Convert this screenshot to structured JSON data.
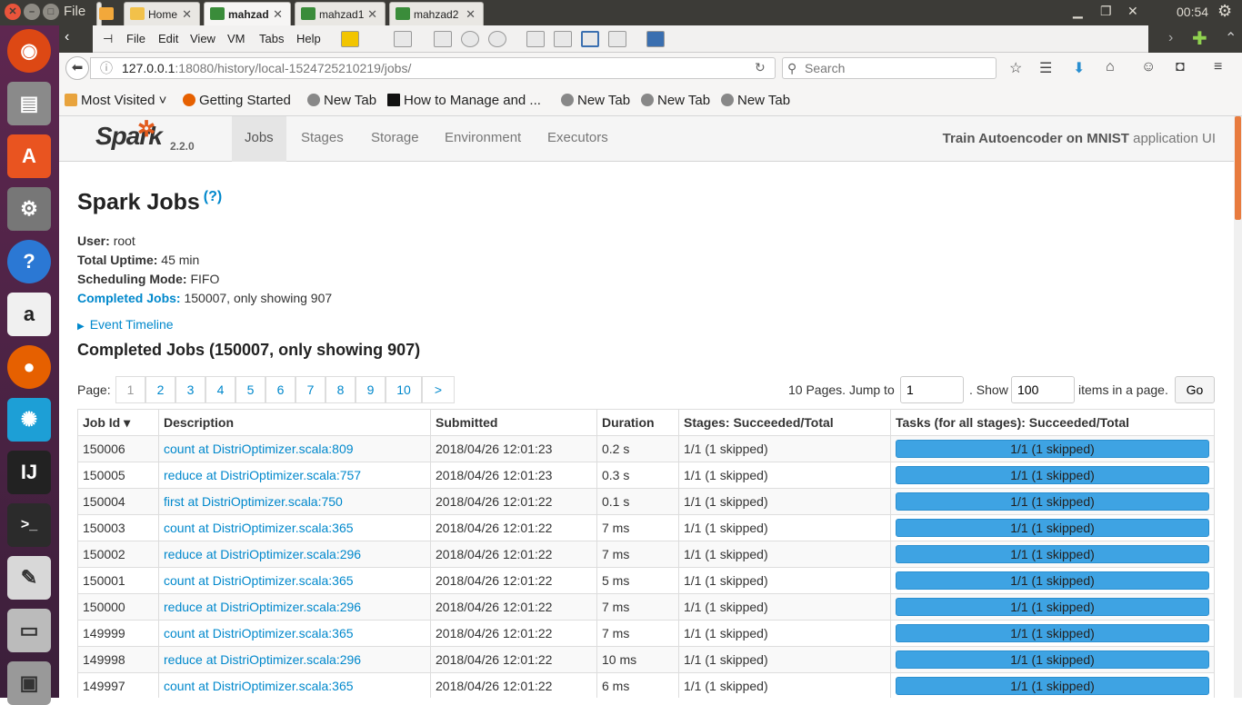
{
  "os": {
    "menu_file": "File",
    "clock": "00:54"
  },
  "browser_tabs": [
    {
      "label": "Home"
    },
    {
      "label": "mahzad"
    },
    {
      "label": "mahzad1"
    },
    {
      "label": "mahzad2"
    }
  ],
  "vm_menu": [
    "File",
    "Edit",
    "View",
    "VM",
    "Tabs",
    "Help"
  ],
  "nav": {
    "url_host": "127.0.0.1",
    "url_path": ":18080/history/local-1524725210219/jobs/",
    "search_placeholder": "Search"
  },
  "bookmarks": [
    {
      "label": "Most Visited ˅"
    },
    {
      "label": "Getting Started"
    },
    {
      "label": "New Tab"
    },
    {
      "label": "How to Manage and ..."
    },
    {
      "label": "New Tab"
    },
    {
      "label": "New Tab"
    },
    {
      "label": "New Tab"
    }
  ],
  "spark": {
    "version": "2.2.0",
    "tabs": [
      "Jobs",
      "Stages",
      "Storage",
      "Environment",
      "Executors"
    ],
    "app_name": "Train Autoencoder on MNIST",
    "app_suffix": " application UI",
    "title": "Spark Jobs",
    "help": "(?)",
    "user_label": "User:",
    "user": "root",
    "uptime_label": "Total Uptime:",
    "uptime": "45 min",
    "mode_label": "Scheduling Mode:",
    "mode": "FIFO",
    "completed_label": "Completed Jobs:",
    "completed": "150007, only showing 907",
    "event_timeline": "Event Timeline",
    "section_title": "Completed Jobs (150007, only showing 907)"
  },
  "pager": {
    "label": "Page:",
    "pages": [
      "1",
      "2",
      "3",
      "4",
      "5",
      "6",
      "7",
      "8",
      "9",
      "10",
      ">"
    ],
    "jump_text": "10 Pages. Jump to",
    "jump_value": "1",
    "show_text": ". Show",
    "show_value": "100",
    "items_text": "items in a page.",
    "go": "Go"
  },
  "table": {
    "headers": [
      "Job Id ▾",
      "Description",
      "Submitted",
      "Duration",
      "Stages: Succeeded/Total",
      "Tasks (for all stages): Succeeded/Total"
    ],
    "rows": [
      {
        "id": "150006",
        "desc": "count at DistriOptimizer.scala:809",
        "submitted": "2018/04/26 12:01:23",
        "duration": "0.2 s",
        "stages": "1/1 (1 skipped)",
        "tasks": "1/1 (1 skipped)"
      },
      {
        "id": "150005",
        "desc": "reduce at DistriOptimizer.scala:757",
        "submitted": "2018/04/26 12:01:23",
        "duration": "0.3 s",
        "stages": "1/1 (1 skipped)",
        "tasks": "1/1 (1 skipped)"
      },
      {
        "id": "150004",
        "desc": "first at DistriOptimizer.scala:750",
        "submitted": "2018/04/26 12:01:22",
        "duration": "0.1 s",
        "stages": "1/1 (1 skipped)",
        "tasks": "1/1 (1 skipped)"
      },
      {
        "id": "150003",
        "desc": "count at DistriOptimizer.scala:365",
        "submitted": "2018/04/26 12:01:22",
        "duration": "7 ms",
        "stages": "1/1 (1 skipped)",
        "tasks": "1/1 (1 skipped)"
      },
      {
        "id": "150002",
        "desc": "reduce at DistriOptimizer.scala:296",
        "submitted": "2018/04/26 12:01:22",
        "duration": "7 ms",
        "stages": "1/1 (1 skipped)",
        "tasks": "1/1 (1 skipped)"
      },
      {
        "id": "150001",
        "desc": "count at DistriOptimizer.scala:365",
        "submitted": "2018/04/26 12:01:22",
        "duration": "5 ms",
        "stages": "1/1 (1 skipped)",
        "tasks": "1/1 (1 skipped)"
      },
      {
        "id": "150000",
        "desc": "reduce at DistriOptimizer.scala:296",
        "submitted": "2018/04/26 12:01:22",
        "duration": "7 ms",
        "stages": "1/1 (1 skipped)",
        "tasks": "1/1 (1 skipped)"
      },
      {
        "id": "149999",
        "desc": "count at DistriOptimizer.scala:365",
        "submitted": "2018/04/26 12:01:22",
        "duration": "7 ms",
        "stages": "1/1 (1 skipped)",
        "tasks": "1/1 (1 skipped)"
      },
      {
        "id": "149998",
        "desc": "reduce at DistriOptimizer.scala:296",
        "submitted": "2018/04/26 12:01:22",
        "duration": "10 ms",
        "stages": "1/1 (1 skipped)",
        "tasks": "1/1 (1 skipped)"
      },
      {
        "id": "149997",
        "desc": "count at DistriOptimizer.scala:365",
        "submitted": "2018/04/26 12:01:22",
        "duration": "6 ms",
        "stages": "1/1 (1 skipped)",
        "tasks": "1/1 (1 skipped)"
      }
    ]
  },
  "colors": {
    "link": "#0088cc",
    "task_bar": "#3ea3e3",
    "launcher": "#5e2750",
    "spark_orange": "#e25a1c"
  }
}
